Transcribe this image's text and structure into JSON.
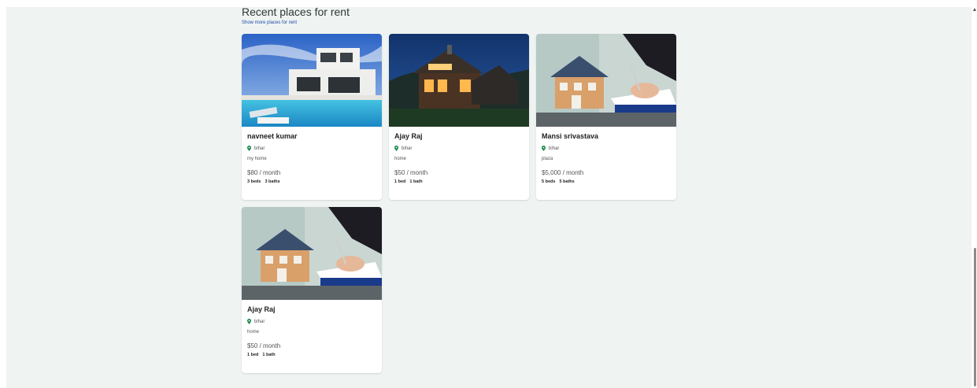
{
  "section": {
    "title": "Recent places for rent",
    "show_more": "Show more places for rent"
  },
  "listings": [
    {
      "image": "modern-villa-with-pool",
      "owner": "navneet kumar",
      "location": "bihar",
      "description": "my home",
      "price": "$80 / month",
      "beds": "3 beds",
      "baths": "3 baths"
    },
    {
      "image": "wooden-house-at-night",
      "owner": "Ajay Raj",
      "location": "bihar",
      "description": "home",
      "price": "$50 / month",
      "beds": "1 bed",
      "baths": "1 bath"
    },
    {
      "image": "house-model-signing-contract",
      "owner": "Mansi srivastava",
      "location": "bihar",
      "description": "plaza",
      "price": "$5,000 / month",
      "beds": "5 beds",
      "baths": "5 baths"
    },
    {
      "image": "house-model-signing-contract",
      "owner": "Ajay Raj",
      "location": "bihar",
      "description": "home",
      "price": "$50 / month",
      "beds": "1 bed",
      "baths": "1 bath"
    }
  ],
  "colors": {
    "background": "#eff3f1",
    "pin": "#1c8c4d",
    "link": "#1f4ea8"
  }
}
